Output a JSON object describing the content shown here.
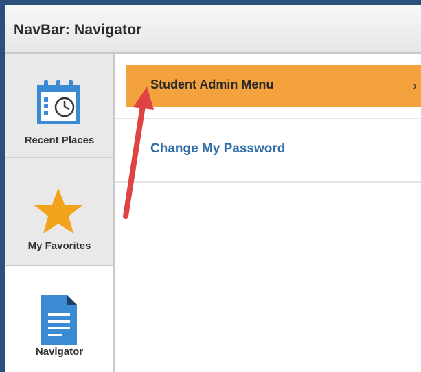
{
  "window": {
    "title": "NavBar: Navigator"
  },
  "sidebar": {
    "items": [
      {
        "label": "Recent Places",
        "icon": "calendar-clock-icon"
      },
      {
        "label": "My Favorites",
        "icon": "star-icon"
      },
      {
        "label": "Navigator",
        "icon": "document-icon",
        "selected": true
      }
    ]
  },
  "main": {
    "items": [
      {
        "label": "Student Admin Menu",
        "chevron": "›",
        "highlighted": true
      },
      {
        "label": "Change My Password"
      }
    ]
  },
  "colors": {
    "frame": "#2c4f7c",
    "highlight": "#f4a23d",
    "link": "#2f6ea8",
    "star": "#f0a31b",
    "icon_blue": "#3b8ad4",
    "annotation_arrow": "#e04343"
  },
  "annotation": {
    "type": "arrow",
    "points_to": "Student Admin Menu"
  }
}
